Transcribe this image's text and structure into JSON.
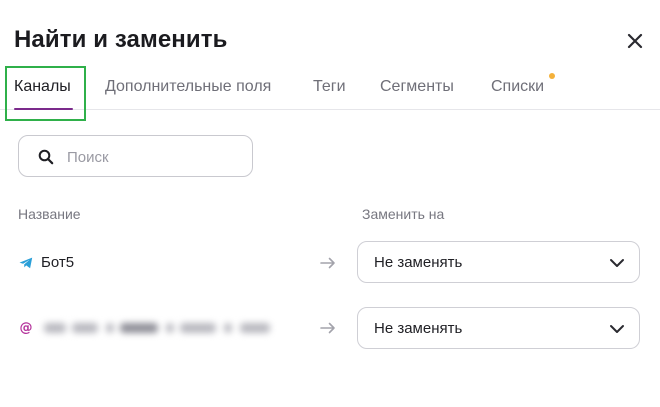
{
  "dialog": {
    "title": "Найти и заменить",
    "close_icon": "close-icon"
  },
  "tabs": [
    {
      "label": "Каналы",
      "active": true
    },
    {
      "label": "Дополнительные поля",
      "active": false
    },
    {
      "label": "Теги",
      "active": false
    },
    {
      "label": "Сегменты",
      "active": false
    },
    {
      "label": "Списки",
      "active": false,
      "has_notification_dot": true
    }
  ],
  "search": {
    "placeholder": "Поиск",
    "value": "",
    "icon": "search-icon"
  },
  "columns": {
    "name": "Название",
    "replace_with": "Заменить на"
  },
  "rows": [
    {
      "channel_icon": "telegram-icon",
      "name": "Бот5",
      "replace_value": "Не заменять"
    },
    {
      "channel_icon": "email-at-icon",
      "name": "",
      "name_obscured": true,
      "replace_value": "Не заменять"
    }
  ],
  "colors": {
    "accent_underline": "#7b2a8b",
    "highlight_box": "#2fb04a",
    "notification_dot": "#f4b13a",
    "telegram": "#2a9fd8",
    "email_at": "#b5359c"
  }
}
